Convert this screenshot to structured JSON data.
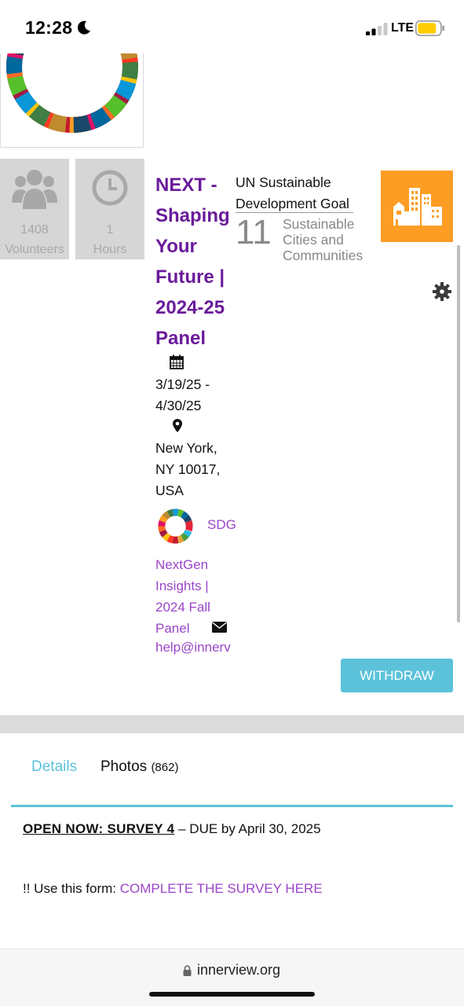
{
  "status_bar": {
    "time": "12:28",
    "network": "LTE",
    "icons": [
      "moon-icon",
      "signal-icon",
      "battery-icon"
    ],
    "battery_color": "#ffcc00"
  },
  "stats": {
    "volunteers": {
      "value": "1408",
      "label": "Volunteers",
      "icon": "users-icon"
    },
    "hours": {
      "value": "1",
      "label": "Hours",
      "icon": "clock-icon"
    }
  },
  "event": {
    "title": "NEXT - Shaping Your Future | 2024-25 Panel",
    "dates": "3/19/25 - 4/30/25",
    "location": "New York, NY 10017, USA",
    "sdg_link": "SDG",
    "org_name": "NextGen Insights | 2024 Fall Panel",
    "email": "help@innerv"
  },
  "sdg_goal": {
    "heading": "UN Sustainable Development Goal",
    "number": "11",
    "name": "Sustainable Cities and Communities",
    "tile_color": "#fd9d24",
    "icon": "city-icon"
  },
  "actions": {
    "withdraw_label": "WITHDRAW"
  },
  "tabs": {
    "details_label": "Details",
    "photos_label": "Photos",
    "photos_count": "(862)"
  },
  "content": {
    "survey_title": "OPEN NOW: SURVEY 4",
    "survey_due": " – DUE by April 30, 2025",
    "form_prefix": "!! Use this form: ",
    "form_link": "COMPLETE THE SURVEY HERE"
  },
  "browser": {
    "url": "innerview.org"
  },
  "colors": {
    "accent": "#5bc2da",
    "title_purple": "#6a1b9a",
    "link_purple": "#9b45c9"
  }
}
